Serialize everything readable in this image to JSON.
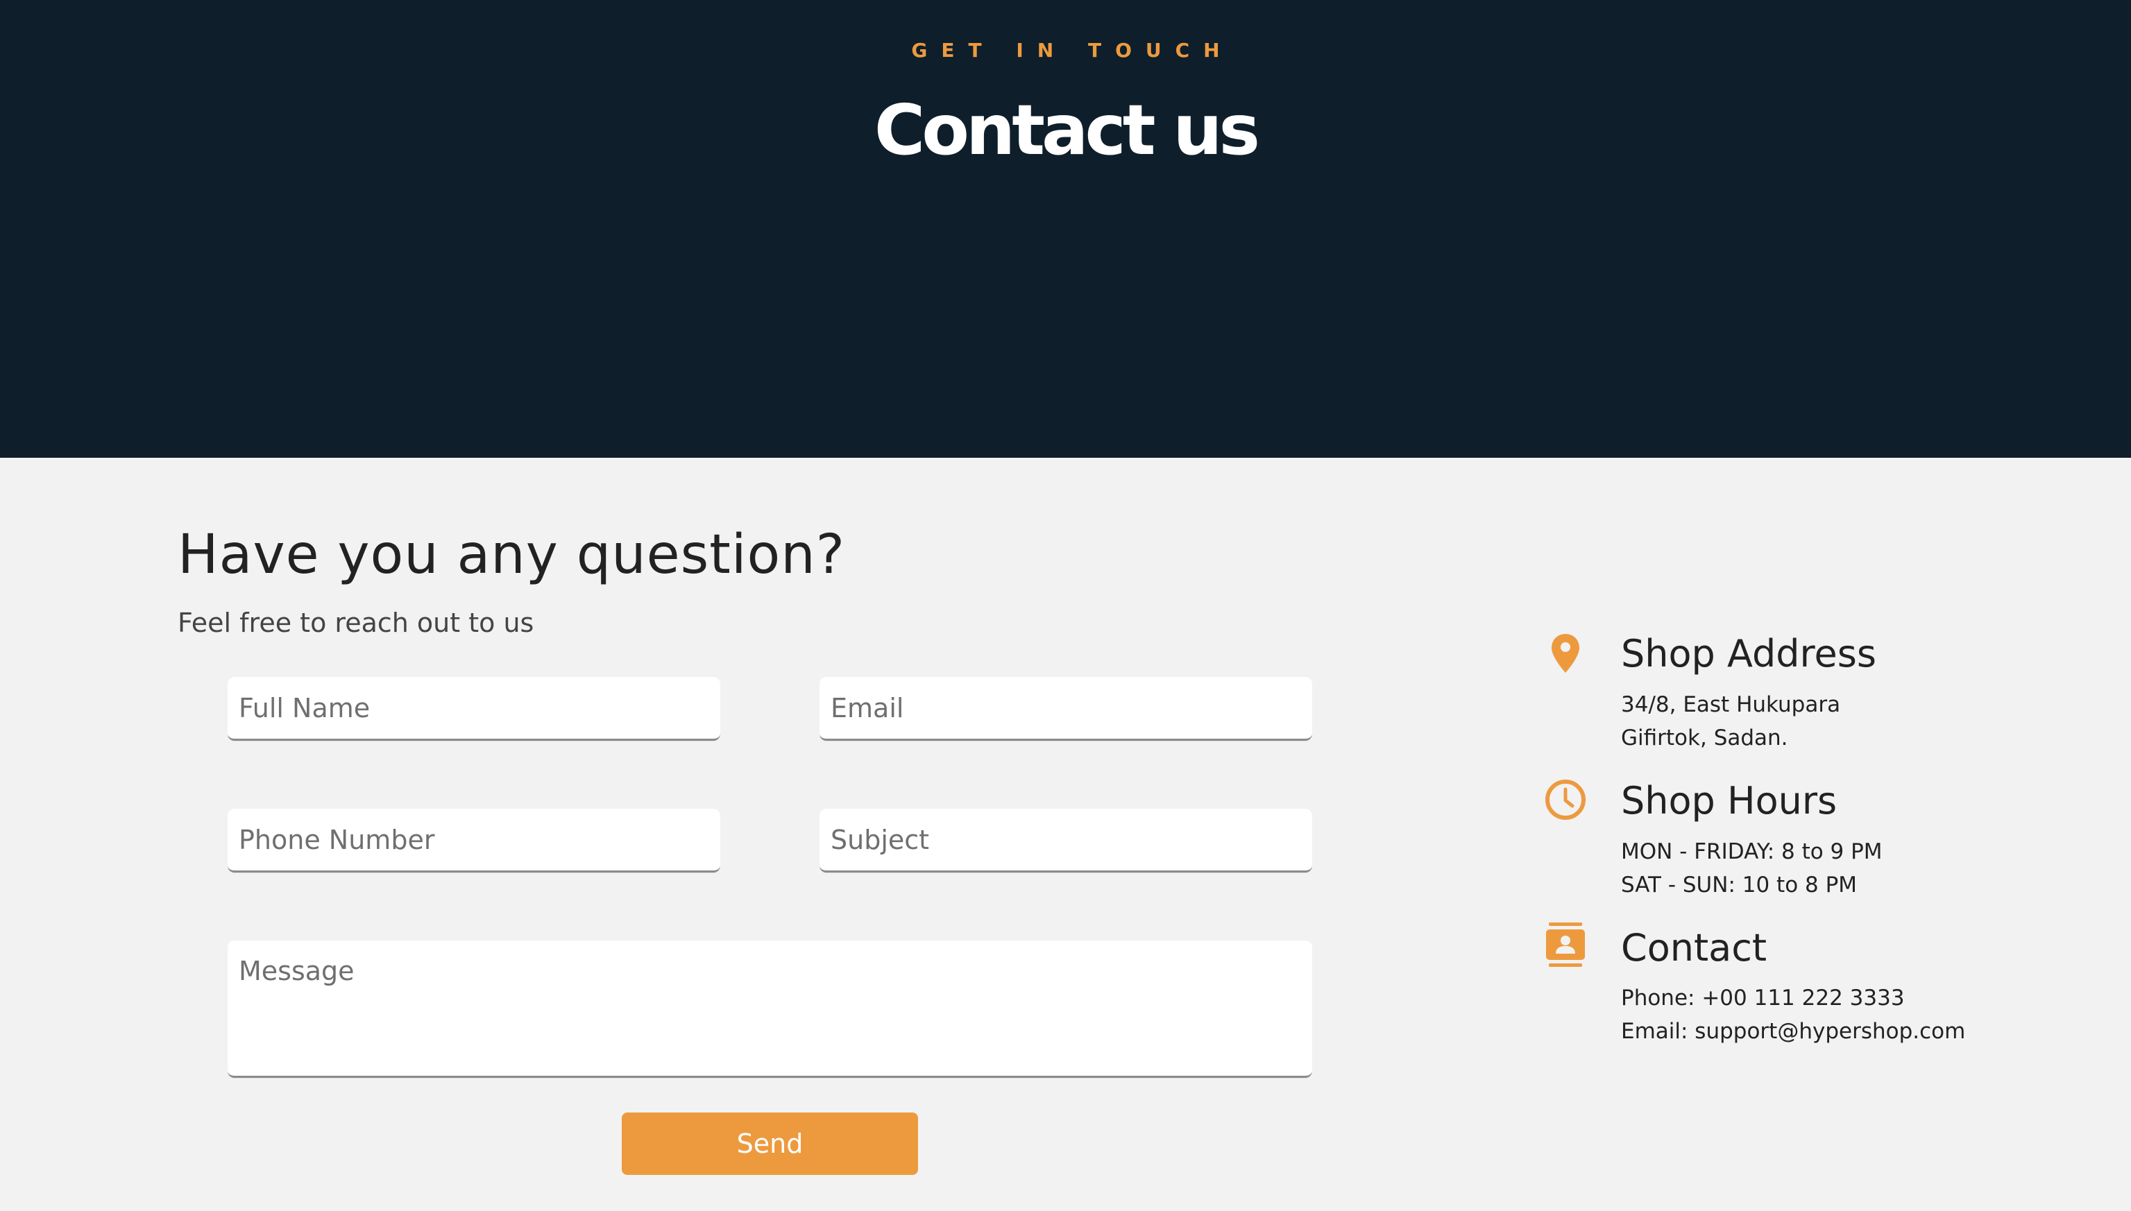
{
  "colors": {
    "hero_background": "#0e1f2b",
    "accent": "#ed9a3f",
    "page_background": "#f2f2f2"
  },
  "hero": {
    "eyebrow": "GET IN TOUCH",
    "title": "Contact us"
  },
  "form": {
    "heading": "Have you any question?",
    "subheading": "Feel free to reach out to us",
    "full_name_placeholder": "Full Name",
    "email_placeholder": "Email",
    "phone_placeholder": "Phone Number",
    "subject_placeholder": "Subject",
    "message_placeholder": "Message",
    "send_label": "Send"
  },
  "info": {
    "address": {
      "icon": "location-pin-icon",
      "title": "Shop Address",
      "lines": [
        "34/8, East Hukupara",
        "Gifirtok, Sadan."
      ]
    },
    "hours": {
      "icon": "clock-icon",
      "title": "Shop Hours",
      "lines": [
        "MON - FRIDAY: 8 to 9 PM",
        "SAT - SUN: 10 to 8 PM"
      ]
    },
    "contact": {
      "icon": "contact-card-icon",
      "title": "Contact",
      "lines": [
        "Phone: +00 111 222 3333",
        "Email: support@hypershop.com"
      ]
    }
  }
}
